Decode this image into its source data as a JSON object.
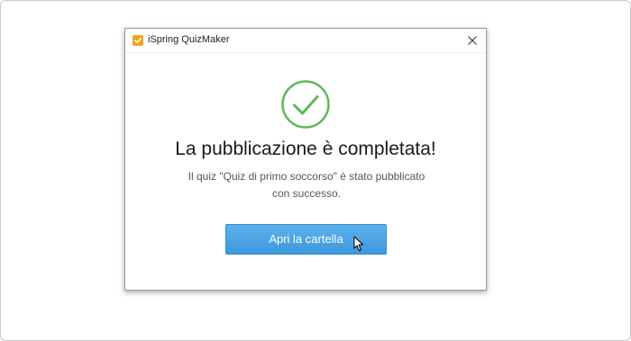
{
  "window": {
    "title": "iSpring QuizMaker",
    "app_icon": "ispring-checkbox-icon",
    "close_icon": "close-icon"
  },
  "status": {
    "icon": "checkmark-circle-icon",
    "accent_color": "#5cb85c"
  },
  "content": {
    "heading": "La pubblicazione è completata!",
    "message": "Il quiz \"Quiz di primo soccorso\" è stato pubblicato con successo."
  },
  "actions": {
    "open_folder_label": "Apri la cartella",
    "button_color": "#4aa3e6"
  }
}
